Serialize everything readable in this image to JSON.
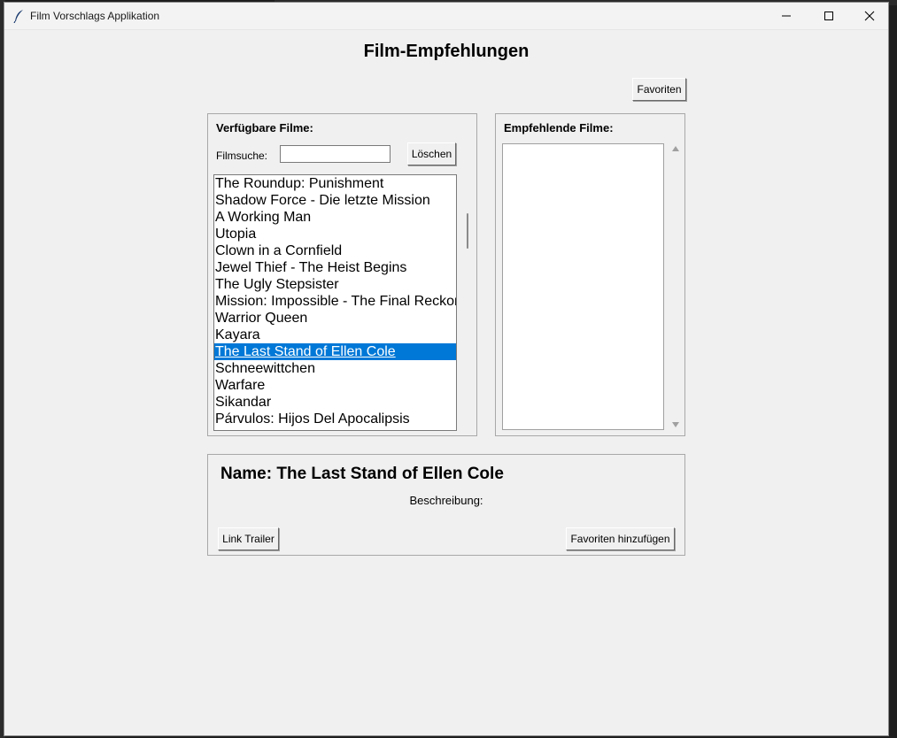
{
  "window": {
    "title": "Film Vorschlags Applikation",
    "controls": [
      "minimize-icon",
      "maximize-icon",
      "close-icon"
    ]
  },
  "main": {
    "heading": "Film-Empfehlungen",
    "favorites_button": "Favoriten"
  },
  "available": {
    "label": "Verfügbare Filme:",
    "search_label": "Filmsuche:",
    "search_value": "",
    "clear_button": "Löschen",
    "selected_index": 10,
    "films": [
      "The Roundup: Punishment",
      "Shadow Force - Die letzte Mission",
      "A Working Man",
      "Utopia",
      "Clown in a Cornfield",
      "Jewel Thief - The Heist Begins",
      "The Ugly Stepsister",
      "Mission: Impossible - The Final Reckoning",
      "Warrior Queen",
      "Kayara",
      "The Last Stand of Ellen Cole",
      "Schneewittchen",
      "Warfare",
      "Sikandar",
      "Párvulos: Hijos Del Apocalipsis"
    ]
  },
  "recommended": {
    "label": "Empfehlende Filme:",
    "items": []
  },
  "details": {
    "name": "Name: The Last Stand of Ellen Cole",
    "description_label": "Beschreibung:",
    "trailer_button": "Link Trailer",
    "add_favorite_button": "Favoriten hinzufügen"
  },
  "colors": {
    "selection": "#0078d7",
    "window_bg": "#f0f0f0"
  }
}
